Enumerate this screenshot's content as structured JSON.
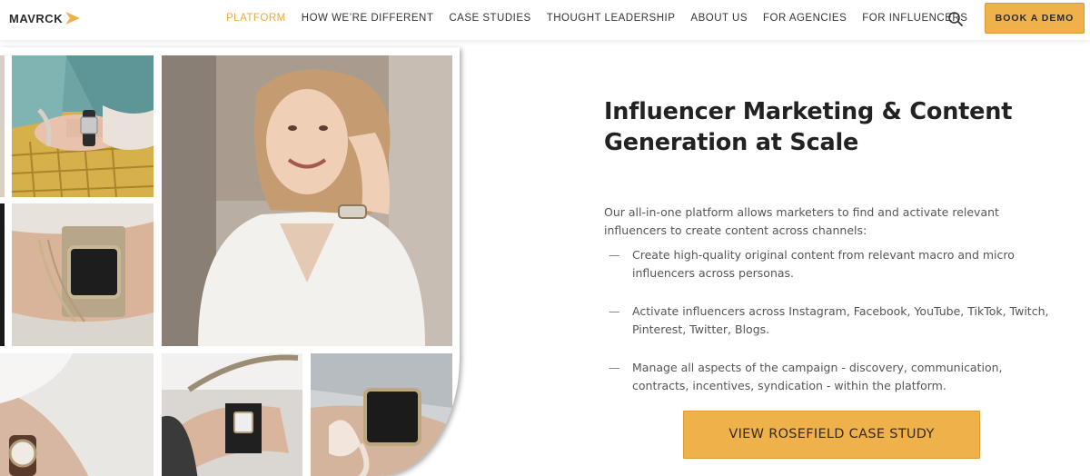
{
  "brand": {
    "name": "MAVRCK",
    "accent": "#efb14a"
  },
  "nav": {
    "items": [
      {
        "label": "PLATFORM",
        "active": true
      },
      {
        "label": "HOW WE’RE DIFFERENT",
        "active": false
      },
      {
        "label": "CASE STUDIES",
        "active": false
      },
      {
        "label": "THOUGHT LEADERSHIP",
        "active": false
      },
      {
        "label": "ABOUT US",
        "active": false
      },
      {
        "label": "FOR AGENCIES",
        "active": false
      },
      {
        "label": "FOR INFLUENCERS",
        "active": false
      }
    ],
    "search_icon": "search-icon",
    "book_demo_label": "BOOK A DEMO"
  },
  "hero": {
    "images": [
      "wrist-watch-sweater",
      "woman-white-shirt",
      "wrist-watch-bracelets",
      "wrist-watch-sleeve",
      "wrist-watch-leaf",
      "wrist-watch-ribbon"
    ],
    "headline": "Influencer Marketing & Content Generation at Scale",
    "intro": "Our all-in-one platform allows marketers to find and activate relevant influencers to create content across channels:",
    "bullets": [
      "Create high-quality original content from relevant macro and micro influencers across personas.",
      "Activate influencers across Instagram, Facebook, YouTube, TikTok, Twitch, Pinterest, Twitter, Blogs.",
      "Manage all aspects of the campaign - discovery, communication, contracts, incentives, syndication - within the platform."
    ],
    "bullet_marker": "—",
    "cta_label": "VIEW ROSEFIELD CASE STUDY"
  }
}
